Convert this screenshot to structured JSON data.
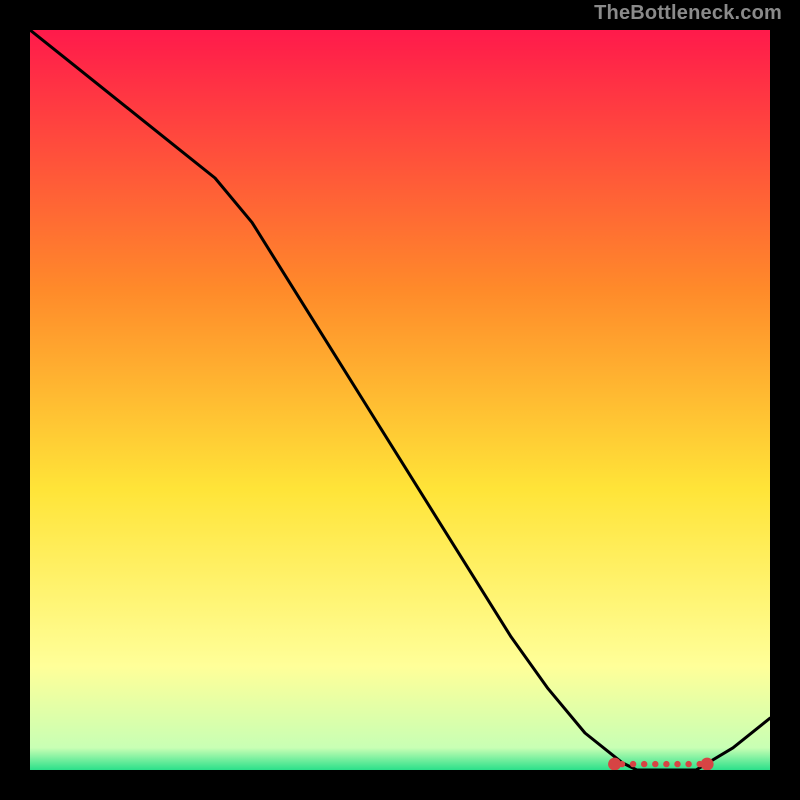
{
  "watermark": "TheBottleneck.com",
  "chart_data": {
    "type": "line",
    "title": "",
    "xlabel": "",
    "ylabel": "",
    "xlim": [
      0,
      100
    ],
    "ylim": [
      0,
      100
    ],
    "grid": false,
    "background_gradient": {
      "top": "#ff1a4b",
      "upper_mid": "#ff8a2a",
      "mid": "#ffe438",
      "lower_mid": "#ffff99",
      "bottom": "#2be08a"
    },
    "series": [
      {
        "name": "bottleneck-curve",
        "color": "#000000",
        "x": [
          0,
          5,
          10,
          15,
          20,
          25,
          30,
          35,
          40,
          45,
          50,
          55,
          60,
          65,
          70,
          75,
          80,
          82,
          85,
          88,
          90,
          95,
          100
        ],
        "y": [
          100,
          96,
          92,
          88,
          84,
          80,
          74,
          66,
          58,
          50,
          42,
          34,
          26,
          18,
          11,
          5,
          1,
          0,
          0,
          0,
          0,
          3,
          7
        ]
      }
    ],
    "markers": [
      {
        "name": "optimal-range-points",
        "color": "#d64444",
        "style": "dot",
        "x": [
          80,
          81.5,
          83,
          84.5,
          86,
          87.5,
          89,
          90.5
        ],
        "y": [
          0.8,
          0.8,
          0.8,
          0.8,
          0.8,
          0.8,
          0.8,
          0.8
        ]
      },
      {
        "name": "optimal-range-endpoint-left",
        "color": "#d64444",
        "style": "big-dot",
        "x": [
          79
        ],
        "y": [
          0.8
        ]
      },
      {
        "name": "optimal-range-endpoint-right",
        "color": "#d64444",
        "style": "big-dot",
        "x": [
          91.5
        ],
        "y": [
          0.8
        ]
      }
    ]
  }
}
